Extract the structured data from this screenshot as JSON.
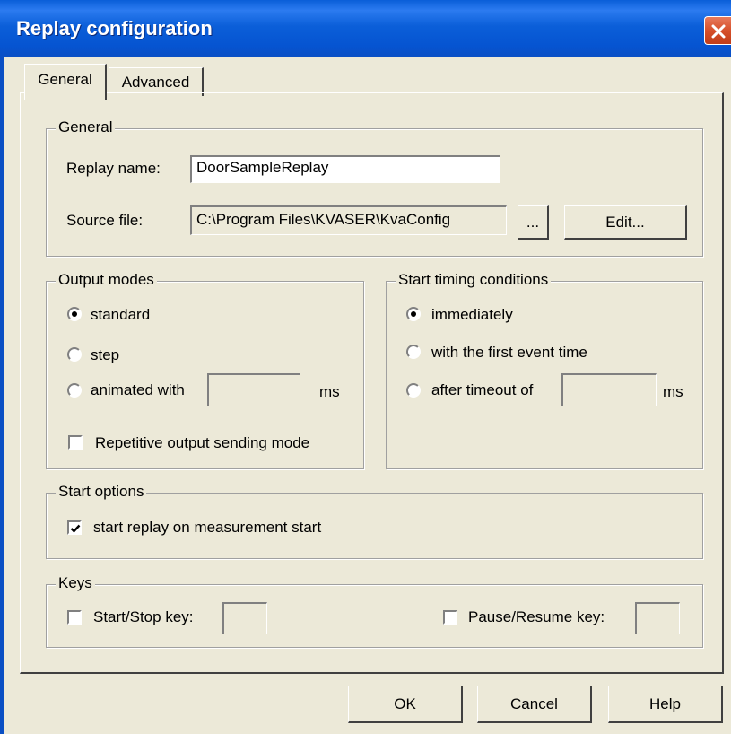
{
  "window": {
    "title": "Replay configuration"
  },
  "tabs": [
    {
      "label": "General",
      "active": true
    },
    {
      "label": "Advanced",
      "active": false
    }
  ],
  "general_group": {
    "label": "General",
    "replay_name_label": "Replay name:",
    "replay_name_value": "DoorSampleReplay",
    "source_file_label": "Source file:",
    "source_file_value": "C:\\Program Files\\KVASER\\KvaConfig",
    "browse_label": "...",
    "edit_label": "Edit..."
  },
  "output_modes": {
    "label": "Output modes",
    "standard": "standard",
    "step": "step",
    "animated": "animated with",
    "animated_value": "",
    "ms_label": "ms",
    "repetitive": "Repetitive output sending mode",
    "selected": "standard",
    "repetitive_checked": false
  },
  "start_timing": {
    "label": "Start timing conditions",
    "immediately": "immediately",
    "first_event": "with the first event time",
    "timeout": "after timeout of",
    "timeout_value": "",
    "ms_label": "ms",
    "selected": "immediately"
  },
  "start_options": {
    "label": "Start options",
    "start_replay": "start replay on measurement start",
    "start_replay_checked": true
  },
  "keys": {
    "label": "Keys",
    "start_stop": "Start/Stop key:",
    "start_stop_value": "",
    "pause_resume": "Pause/Resume key:",
    "pause_resume_value": ""
  },
  "buttons": {
    "ok": "OK",
    "cancel": "Cancel",
    "help": "Help"
  },
  "colors": {
    "titlebar": "#0a5ed8",
    "face": "#ece9d8",
    "close": "#d6502b"
  },
  "icons": {
    "close": "close-icon",
    "checkmark": "checkmark-icon"
  }
}
